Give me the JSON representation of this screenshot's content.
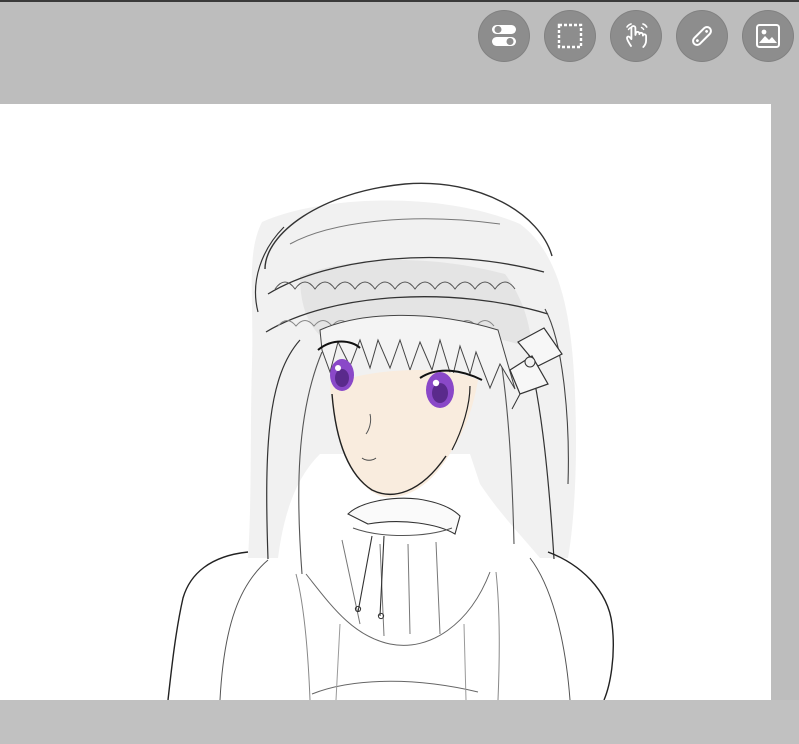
{
  "toolbar": {
    "buttons": [
      {
        "id": "toggle",
        "icon": "toggle-switch-icon"
      },
      {
        "id": "select",
        "icon": "selection-rectangle-icon"
      },
      {
        "id": "gesture",
        "icon": "touch-gesture-icon"
      },
      {
        "id": "ruler",
        "icon": "ruler-icon"
      },
      {
        "id": "image",
        "icon": "image-icon"
      }
    ]
  },
  "colors": {
    "app_background": "#bdbdbd",
    "button_fill": "#8d8d8d",
    "icon": "#ffffff",
    "canvas": "#ffffff",
    "eye_purple": "#8a48c8",
    "skin": "#f7e8d9",
    "lineart": "#2f2f2f",
    "hair_shade": "#ececec"
  }
}
